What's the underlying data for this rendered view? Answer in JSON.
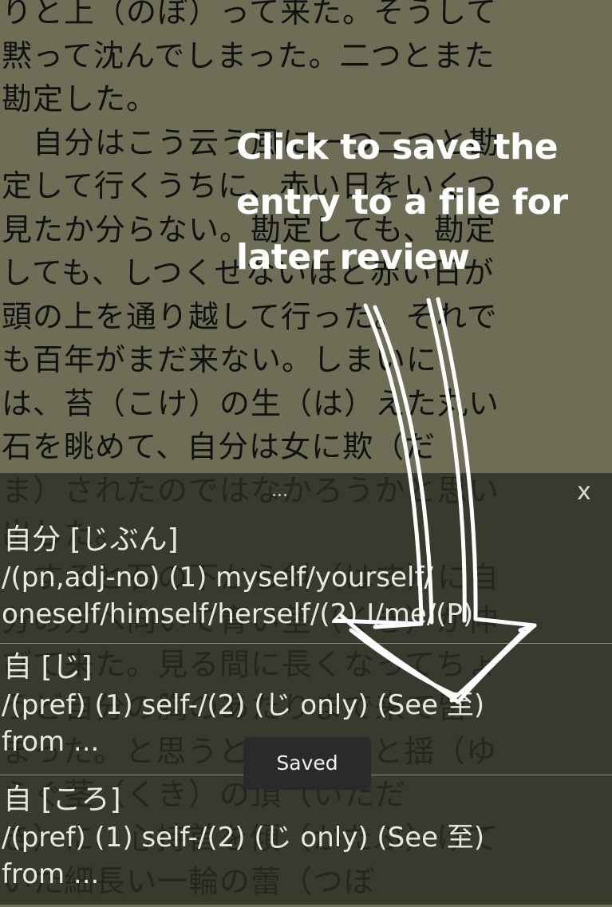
{
  "reader": {
    "text": "りと上（のぼ）って来た。そうして\n黙って沈んでしまった。二つとまた\n勘定した。\n　自分はこう云う風に一つ二つと勘\n定して行くうちに、赤い日をいくつ\n見たか分らない。勘定しても、勘定\nしても、しつくせないほど赤い日が\n頭の上を通り越して行った。それで\nも百年がまだ来ない。しまいに\nは、苔（こけ）の生（は）えた丸い\n石を眺めて、自分は女に欺（だ\nま）されたのではなかろうかと思い\n出した。\n　すると石の下から斜（はす）に自\n分の方へ向いて青い茎（くき）が伸\nびて来た。見る間に長くなってちょ\nうど自分の胸のあたりまで来て留\nまった。と思うと、すらりと揺（ゆ\nらぐ茎（くき）の頂（いただ\nき）に、心持首を傾（かたぶ）けて\nいた細長い一輪の蕾（つぼ"
  },
  "panel": {
    "dots": "...",
    "close": "x"
  },
  "entries": [
    {
      "headword": "自分 [じぶん]",
      "gloss": "/(pn,adj-no) (1) myself/yourself/\noneself/himself/herself/(2) I/me/(P)"
    },
    {
      "headword": "自 [じ]",
      "gloss": "/(pref) (1) self-/(2) (じ only) (See 至)\nfrom ..."
    },
    {
      "headword": "自 [ころ]",
      "gloss": "/(pref) (1) self-/(2) (じ only) (See 至)\nfrom ..."
    }
  ],
  "tip": {
    "text": "Click to save the entry to a file for later review"
  },
  "toast": {
    "text": "Saved"
  },
  "icons": {
    "close": "close-icon",
    "arrow": "arrow-annotation"
  },
  "colors": {
    "reader_bg": "#6e6e56",
    "panel_bg": "#2c2c24",
    "toast_bg": "#2a2a2a"
  }
}
